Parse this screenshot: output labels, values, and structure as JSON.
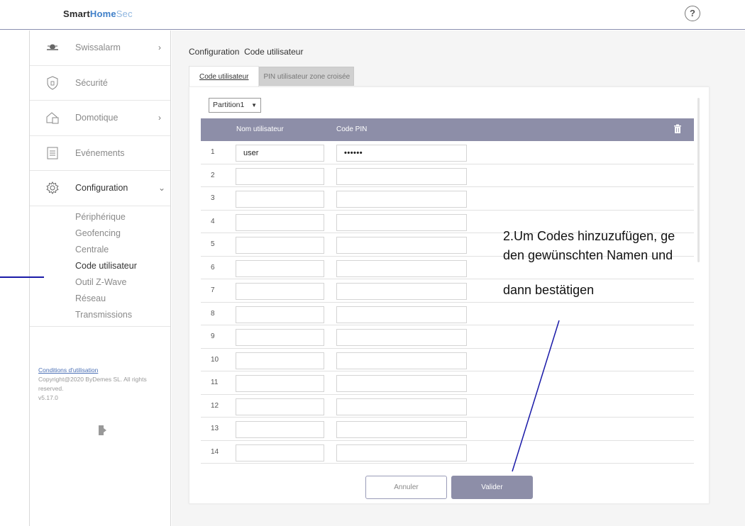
{
  "brand": {
    "part1": "Smart",
    "part2": "Home",
    "part3": "Sec"
  },
  "help_label": "?",
  "sidebar": {
    "items": [
      {
        "label": "Swissalarm",
        "icon": "swissalarm-logo-icon",
        "arrow": "›"
      },
      {
        "label": "Sécurité",
        "icon": "shield-icon",
        "arrow": ""
      },
      {
        "label": "Domotique",
        "icon": "smart-home-icon",
        "arrow": "›"
      },
      {
        "label": "Evénements",
        "icon": "list-icon",
        "arrow": ""
      },
      {
        "label": "Configuration",
        "icon": "gear-icon",
        "arrow": "⌄"
      }
    ],
    "sub_items": [
      "Périphérique",
      "Geofencing",
      "Centrale",
      "Code utilisateur",
      "Outil Z-Wave",
      "Réseau",
      "Transmissions"
    ],
    "active_sub": "Code utilisateur"
  },
  "footer": {
    "terms": "Conditions d'utilisation",
    "copyright": "Copyright@2020 ByDemes SL. All rights reserved.",
    "version": "v5.17.0"
  },
  "breadcrumb": {
    "section": "Configuration",
    "page": "Code utilisateur"
  },
  "tabs": [
    {
      "label": "Code utilisateur",
      "active": true
    },
    {
      "label": "PIN utilisateur zone croisée",
      "active": false
    }
  ],
  "partition": {
    "selected": "Partition1"
  },
  "table": {
    "headers": {
      "name": "Nom utilisateur",
      "pin": "Code PIN"
    },
    "rows": [
      {
        "num": "1",
        "name": "user",
        "pin": "••••••"
      },
      {
        "num": "2",
        "name": "",
        "pin": ""
      },
      {
        "num": "3",
        "name": "",
        "pin": ""
      },
      {
        "num": "4",
        "name": "",
        "pin": ""
      },
      {
        "num": "5",
        "name": "",
        "pin": ""
      },
      {
        "num": "6",
        "name": "",
        "pin": ""
      },
      {
        "num": "7",
        "name": "",
        "pin": ""
      },
      {
        "num": "8",
        "name": "",
        "pin": ""
      },
      {
        "num": "9",
        "name": "",
        "pin": ""
      },
      {
        "num": "10",
        "name": "",
        "pin": ""
      },
      {
        "num": "11",
        "name": "",
        "pin": ""
      },
      {
        "num": "12",
        "name": "",
        "pin": ""
      },
      {
        "num": "13",
        "name": "",
        "pin": ""
      },
      {
        "num": "14",
        "name": "",
        "pin": ""
      }
    ]
  },
  "buttons": {
    "cancel": "Annuler",
    "confirm": "Valider"
  },
  "annotation": {
    "line1": "2.Um Codes hinzuzufügen, ge",
    "line2": "den gewünschten Namen und",
    "line3": "dann bestätigen",
    "color": "#1a1aa8"
  },
  "colors": {
    "header_bg": "#8d8ea8",
    "brand_blue": "#3f7fc8",
    "annotation_blue": "#1a1aa8"
  }
}
